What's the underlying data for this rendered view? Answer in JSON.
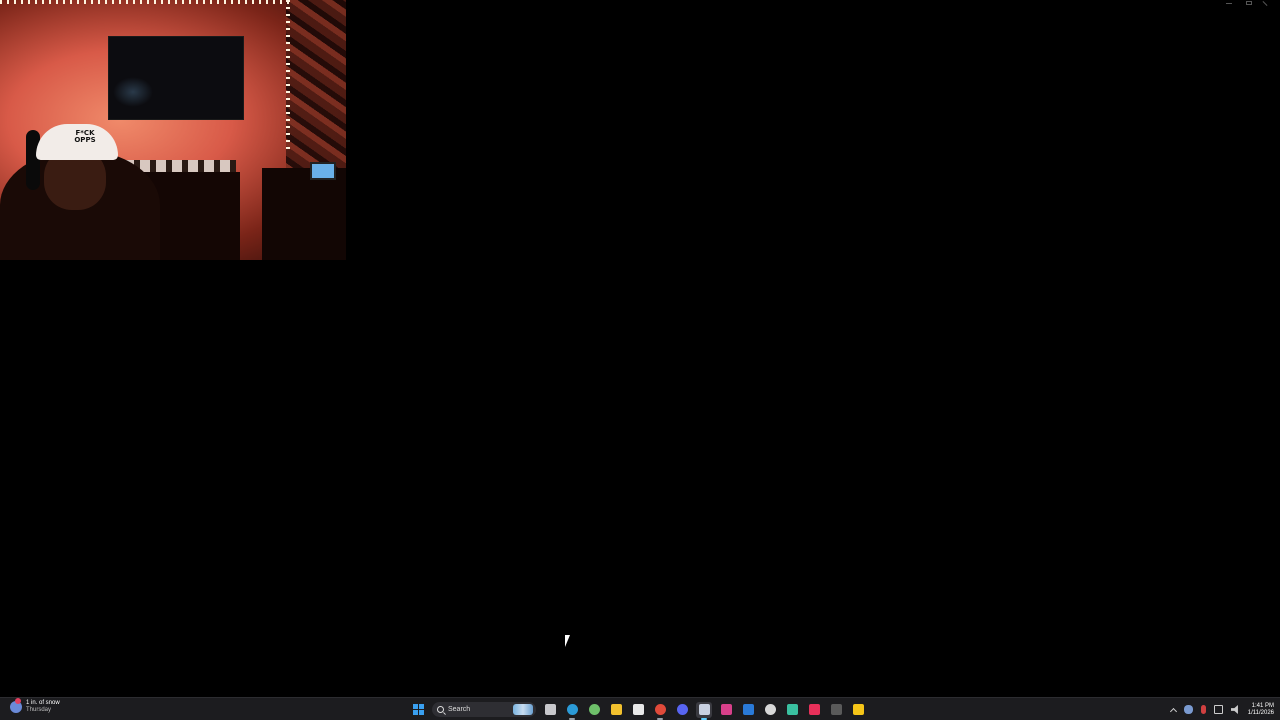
{
  "window": {
    "controls": [
      "minimize-icon",
      "maximize-icon",
      "close-icon"
    ]
  },
  "webcam": {
    "cap_text_line1": "F*CK",
    "cap_text_line2": "OPPS"
  },
  "taskbar": {
    "weather": {
      "temp": "1 in. of snow",
      "day": "Thursday"
    },
    "search_label": "Search",
    "pinned": [
      {
        "name": "task-view-icon",
        "color": "#c8c8cc"
      },
      {
        "name": "edge-icon",
        "color": "#2b9bd8"
      },
      {
        "name": "copilot-icon",
        "color": "#6ec06a"
      },
      {
        "name": "file-explorer-icon",
        "color": "#f2c12e"
      },
      {
        "name": "calendar-icon",
        "color": "#e8e8e8"
      },
      {
        "name": "chrome-icon",
        "color": "#e04a3a"
      },
      {
        "name": "discord-icon",
        "color": "#5865f2"
      },
      {
        "name": "steam-icon",
        "color": "#c8d0e0"
      },
      {
        "name": "instagram-icon",
        "color": "#d8408a"
      },
      {
        "name": "media-player-icon",
        "color": "#2a7ad8"
      },
      {
        "name": "chatgpt-icon",
        "color": "#d8d8d8"
      },
      {
        "name": "store-icon",
        "color": "#3ac0a0"
      },
      {
        "name": "tiktok-icon",
        "color": "#e8305a"
      },
      {
        "name": "excel-icon",
        "color": "#5a5a5a"
      },
      {
        "name": "sticky-notes-icon",
        "color": "#f5c518"
      }
    ],
    "clock": {
      "time": "1:41 PM",
      "date": "1/11/2026"
    }
  }
}
